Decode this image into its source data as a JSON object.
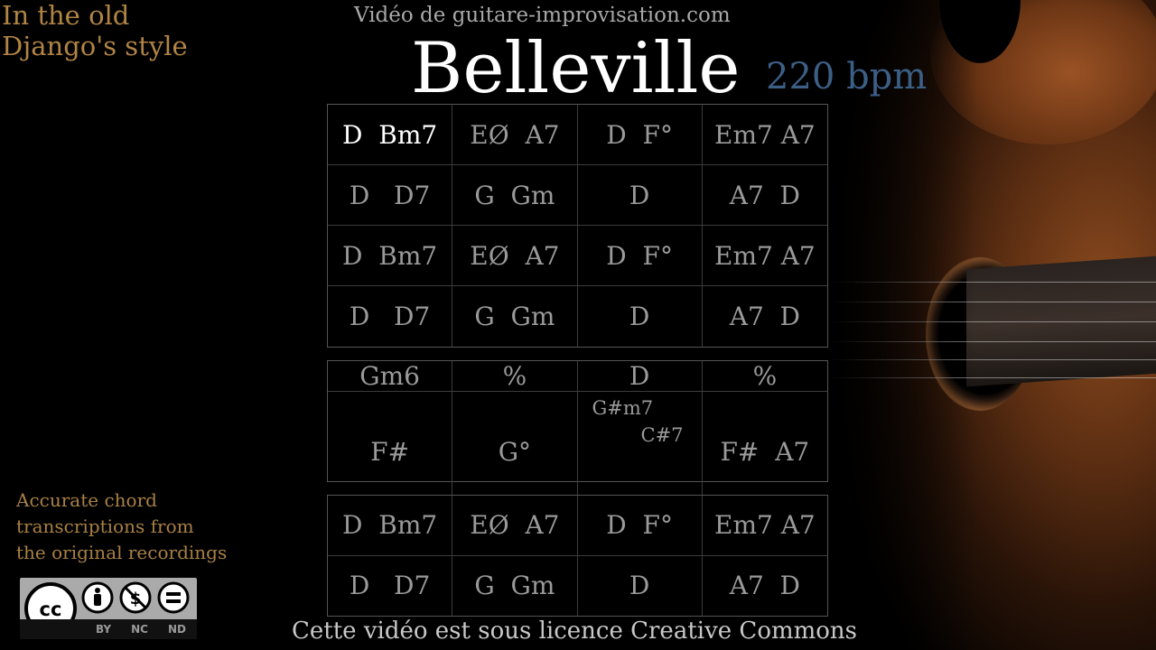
{
  "header": {
    "style_line1": "In the old",
    "style_line2": "Django's style",
    "site": "Vidéo de guitare-improvisation.com",
    "title": "Belleville",
    "tempo": "220 bpm"
  },
  "grids": {
    "a": [
      "D  Bm7",
      "EØ  A7",
      "D  F°",
      "Em7 A7",
      "D   D7",
      "G  Gm",
      "D",
      "A7  D",
      "D  Bm7",
      "EØ  A7",
      "D  F°",
      "Em7 A7",
      "D   D7",
      "G  Gm",
      "D",
      "A7  D"
    ],
    "b": [
      "Gm6",
      "%",
      "D",
      "%",
      "F#",
      "G°",
      "",
      "F#  A7"
    ],
    "b_split": {
      "upper": "G#m7",
      "lower": "C#7"
    },
    "c": [
      "D  Bm7",
      "EØ  A7",
      "D  F°",
      "Em7 A7",
      "D   D7",
      "G  Gm",
      "D",
      "A7  D"
    ]
  },
  "side_note": {
    "line1": "Accurate chord",
    "line2": "transcriptions from",
    "line3": "the original recordings"
  },
  "license_badge": {
    "icons": [
      "cc-icon",
      "person-icon",
      "no-dollar-icon",
      "equals-icon"
    ],
    "labels": [
      "BY",
      "NC",
      "ND"
    ]
  },
  "footer": "Cette vidéo est sous licence Creative Commons",
  "colors": {
    "title": "#ffffff",
    "tempo": "#3c5f86",
    "accent_gold": "#b08444",
    "chord_dim": "#9a9a9a",
    "chord_active": "#ffffff"
  }
}
